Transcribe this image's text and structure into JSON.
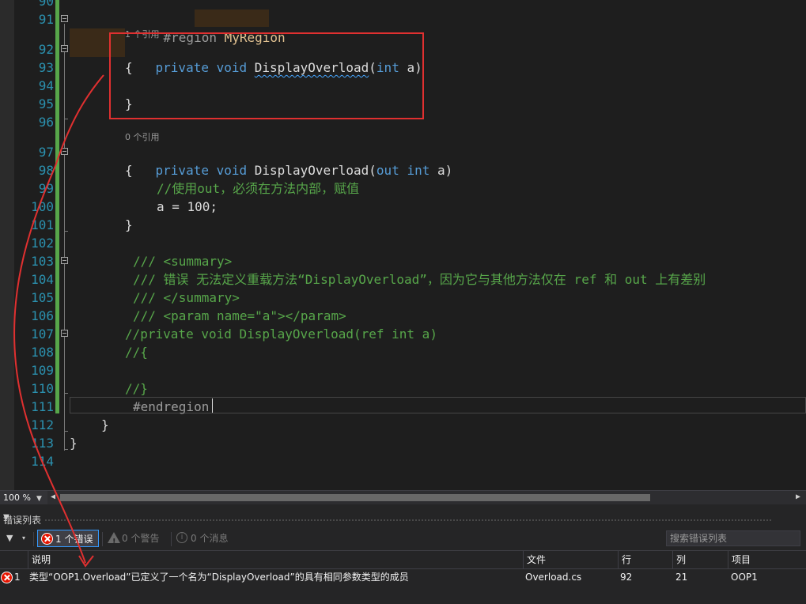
{
  "editor": {
    "line_numbers": [
      "90",
      "91",
      "92",
      "93",
      "94",
      "95",
      "96",
      "97",
      "98",
      "99",
      "100",
      "101",
      "102",
      "103",
      "104",
      "105",
      "106",
      "107",
      "108",
      "109",
      "110",
      "111",
      "112",
      "113",
      "114"
    ],
    "region_start": "#region",
    "region_name": "MyRegion",
    "ref_count_1": "1 个引用",
    "ref_count_0": "0 个引用",
    "kw_private": "private",
    "kw_void": "void",
    "kw_int": "int",
    "kw_out": "out",
    "method_name": "DisplayOverload",
    "param_a": "a)",
    "open_paren": "(",
    "open_brace": "{",
    "close_brace": "}",
    "comment_out": "//使用out，必须在方法内部，赋值",
    "assign": "a = 100;",
    "doc_summary_open": "/// <summary>",
    "doc_error": "/// 错误 无法定义重载方法“DisplayOverload”，因为它与其他方法仅在 ref 和 out 上有差别",
    "doc_summary_close": "/// </summary>",
    "doc_param": "/// <param name=\"a\"></param>",
    "commented_method": "//private void DisplayOverload(ref int a)",
    "commented_open": "//{",
    "commented_close": "//}",
    "endregion": "#endregion",
    "class_close": "}",
    "ns_close": "}"
  },
  "zoom": {
    "level": "100 %"
  },
  "error_list": {
    "title": "错误列表",
    "errors_label": "1 个错误",
    "warnings_label": "0 个警告",
    "messages_label": "0 个消息",
    "search_placeholder": "搜索错误列表",
    "columns": [
      "说明",
      "文件",
      "行",
      "列",
      "项目"
    ],
    "rows": [
      {
        "index": "1",
        "description": "类型“OOP1.Overload”已定义了一个名为“DisplayOverload”的具有相同参数类型的成员",
        "file": "Overload.cs",
        "line": "92",
        "column": "21",
        "project": "OOP1"
      }
    ]
  },
  "colors": {
    "keyword": "#569cd6",
    "comment": "#57a64a",
    "line_number": "#2b91af",
    "annotation": "#e03030",
    "error": "#e51400"
  }
}
